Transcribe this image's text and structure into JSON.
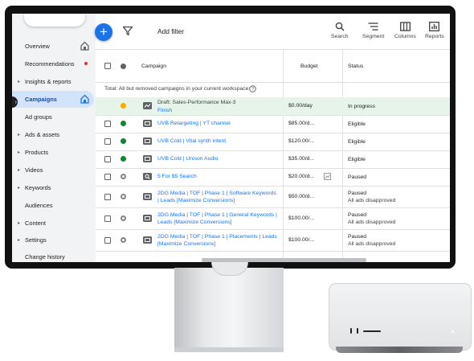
{
  "sidebar": {
    "items": [
      {
        "label": "Overview",
        "caret": false,
        "icon": "home-icon"
      },
      {
        "label": "Recommendations",
        "caret": false,
        "icon": "notification-dot"
      },
      {
        "label": "Insights & reports",
        "caret": true
      },
      {
        "label": "Campaigns",
        "caret": false,
        "icon": "home-icon",
        "active": true
      },
      {
        "label": "Ad groups",
        "caret": false
      },
      {
        "label": "Ads & assets",
        "caret": true
      },
      {
        "label": "Products",
        "caret": true
      },
      {
        "label": "Videos",
        "caret": true
      },
      {
        "label": "Keywords",
        "caret": true
      },
      {
        "label": "Audiences",
        "caret": false
      },
      {
        "label": "Content",
        "caret": true
      },
      {
        "label": "Settings",
        "caret": true
      },
      {
        "label": "Change history",
        "caret": false
      }
    ]
  },
  "toolbar": {
    "add_filter": "Add filter",
    "tools": [
      {
        "label": "Search",
        "icon": "search-icon"
      },
      {
        "label": "Segment",
        "icon": "segment-icon"
      },
      {
        "label": "Columns",
        "icon": "columns-icon"
      },
      {
        "label": "Reports",
        "icon": "reports-icon"
      }
    ]
  },
  "table": {
    "headers": {
      "campaign": "Campaign",
      "budget": "Budget",
      "status": "Status"
    },
    "total_row": "Total: All but removed campaigns in your current workspace",
    "rows": [
      {
        "type": "draft",
        "status_color": "#f9ab00",
        "campaign": "Draft: Sales-Performance Max-3",
        "action": "Finish",
        "budget": "$0.00/day",
        "status": "In progress",
        "status_sub": ""
      },
      {
        "type": "video",
        "status_color": "#188038",
        "campaign": "UVB Retargeting | YT channel",
        "budget": "$85.00/d...",
        "status": "Eligible",
        "status_sub": ""
      },
      {
        "type": "video",
        "status_color": "#188038",
        "campaign": "UVB Cold | Vital synth intent",
        "budget": "$120.00/...",
        "status": "Eligible",
        "status_sub": ""
      },
      {
        "type": "video",
        "status_color": "#188038",
        "campaign": "UVB Cold | Unison Audio",
        "budget": "$35.00/d...",
        "status": "Eligible",
        "status_sub": ""
      },
      {
        "type": "search",
        "status_color": "#80868b",
        "campaign": "5 For $5 Search",
        "budget": "$20.00/d...",
        "status": "Paused",
        "status_sub": ""
      },
      {
        "type": "video",
        "status_color": "#80868b",
        "campaign": "2DG Media | TOF | Phase 1 | Software Keywords | Leads [Maximize Conversions]",
        "budget": "$50.00/d...",
        "status": "Paused",
        "status_sub": "All ads disapproved"
      },
      {
        "type": "video",
        "status_color": "#80868b",
        "campaign": "2DG Media | TOF | Phase 1 | General Keywords | Leads [Maximize Conversions]",
        "budget": "$100.00/...",
        "status": "Paused",
        "status_sub": "All ads disapproved"
      },
      {
        "type": "video",
        "status_color": "#80868b",
        "campaign": "2DG Media | TOF | Phase 1 | Placements | Leads [Maximize Conversions]",
        "budget": "$100.00/...",
        "status": "Paused",
        "status_sub": "All ads disapproved"
      }
    ]
  },
  "colors": {
    "accent": "#1a73e8",
    "active_nav": "#d2e3fc",
    "draft_row": "#e6f4ea"
  }
}
